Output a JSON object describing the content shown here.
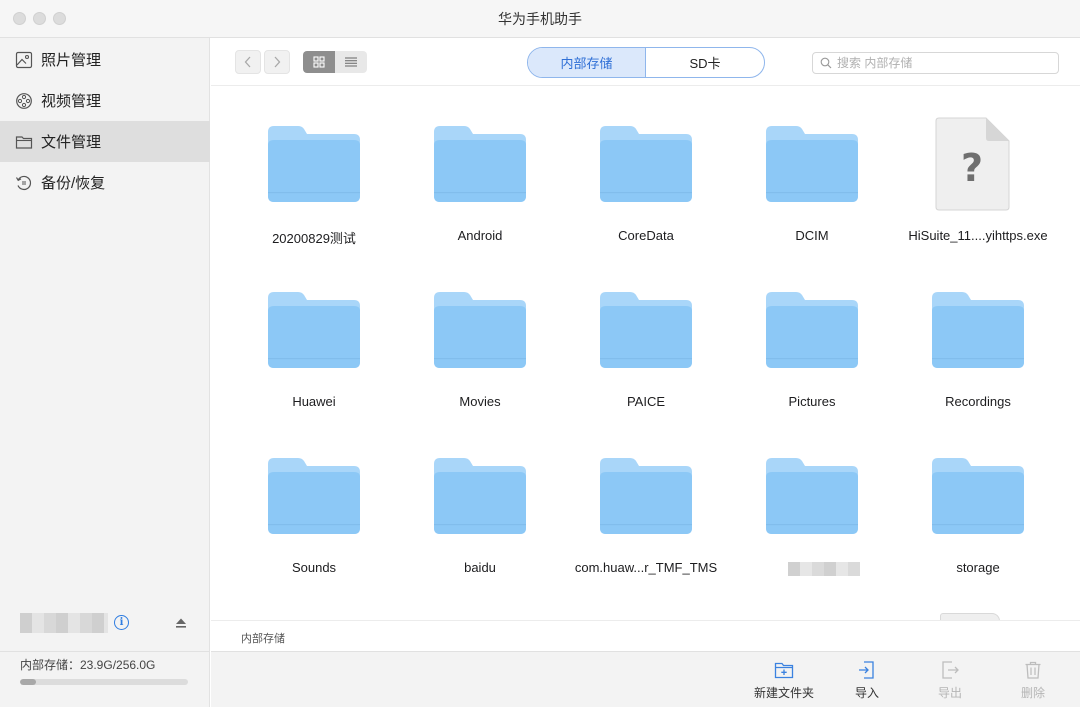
{
  "window": {
    "title": "华为手机助手"
  },
  "sidebar": {
    "items": [
      {
        "label": "照片管理",
        "icon": "photo-icon",
        "active": false
      },
      {
        "label": "视频管理",
        "icon": "video-icon",
        "active": false
      },
      {
        "label": "文件管理",
        "icon": "folder-icon",
        "active": true
      },
      {
        "label": "备份/恢复",
        "icon": "backup-icon",
        "active": false
      }
    ],
    "storage_label": "内部存储：23.9G/256.0G",
    "storage_used_fraction": 0.093
  },
  "toolbar": {
    "segments": [
      {
        "label": "内部存储",
        "active": true
      },
      {
        "label": "SD卡",
        "active": false
      }
    ],
    "search_placeholder": "搜索 内部存储"
  },
  "files": [
    {
      "name": "20200829测试",
      "type": "folder"
    },
    {
      "name": "Android",
      "type": "folder"
    },
    {
      "name": "CoreData",
      "type": "folder"
    },
    {
      "name": "DCIM",
      "type": "folder"
    },
    {
      "name": "HiSuite_11....yihttps.exe",
      "type": "file"
    },
    {
      "name": "Huawei",
      "type": "folder"
    },
    {
      "name": "Movies",
      "type": "folder"
    },
    {
      "name": "PAICE",
      "type": "folder"
    },
    {
      "name": "Pictures",
      "type": "folder"
    },
    {
      "name": "Recordings",
      "type": "folder"
    },
    {
      "name": "Sounds",
      "type": "folder"
    },
    {
      "name": "baidu",
      "type": "folder"
    },
    {
      "name": "com.huaw...r_TMF_TMS",
      "type": "folder"
    },
    {
      "name": "",
      "type": "folder"
    },
    {
      "name": "storage",
      "type": "folder"
    }
  ],
  "pathbar": {
    "path": "内部存储"
  },
  "actions": [
    {
      "label": "新建文件夹",
      "enabled": true
    },
    {
      "label": "导入",
      "enabled": true
    },
    {
      "label": "导出",
      "enabled": false
    },
    {
      "label": "删除",
      "enabled": false
    }
  ],
  "colors": {
    "accent": "#2f6fd6",
    "folder_body": "#8cc8f6",
    "folder_tab": "#a9d6f9"
  }
}
